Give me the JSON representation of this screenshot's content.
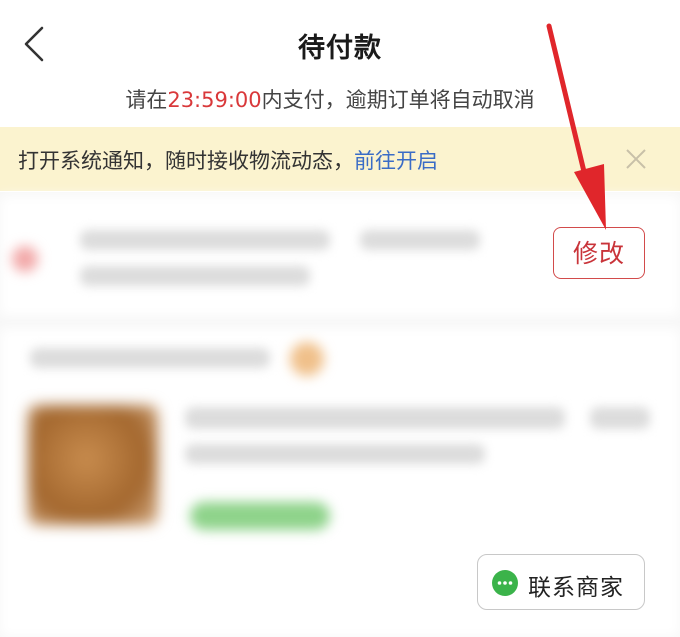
{
  "header": {
    "title": "待付款",
    "subtitle_prefix": "请在",
    "countdown": "23:59:00",
    "subtitle_suffix": "内支付，逾期订单将自动取消"
  },
  "notice": {
    "text": "打开系统通知，随时接收物流动态，",
    "link": "前往开启"
  },
  "edit_button": {
    "label": "修改"
  },
  "contact_button": {
    "label": "联系商家"
  },
  "colors": {
    "countdown": "#d9383a",
    "notice_bg": "#fbf3cf",
    "link": "#3a6cc6",
    "edit_accent": "#d24b4b",
    "chat_icon": "#3bb34a",
    "arrow": "#e0262b"
  },
  "icons": [
    "back-arrow-icon",
    "close-icon",
    "chat-bubble-icon"
  ]
}
